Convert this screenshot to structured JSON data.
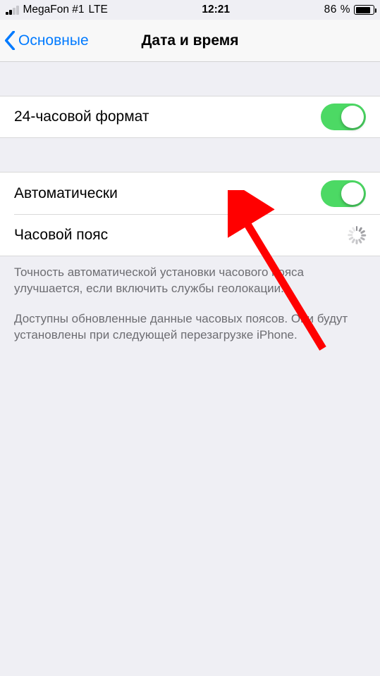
{
  "statusBar": {
    "carrier": "MegaFon #1",
    "network": "LTE",
    "time": "12:21",
    "battery_pct": "86 %"
  },
  "nav": {
    "back_label": "Основные",
    "title": "Дата и время"
  },
  "rows": {
    "time_format_24h": "24-часовой формат",
    "automatic": "Автоматически",
    "timezone": "Часовой пояс"
  },
  "footer": {
    "p1": "Точность автоматической установки часового пояса улучшается, если включить службы геолокации.",
    "p2": "Доступны обновленные данные часовых поясов. Они будут установлены при следующей перезагрузке iPhone."
  },
  "switches": {
    "time_format_24h_on": true,
    "automatic_on": true
  }
}
